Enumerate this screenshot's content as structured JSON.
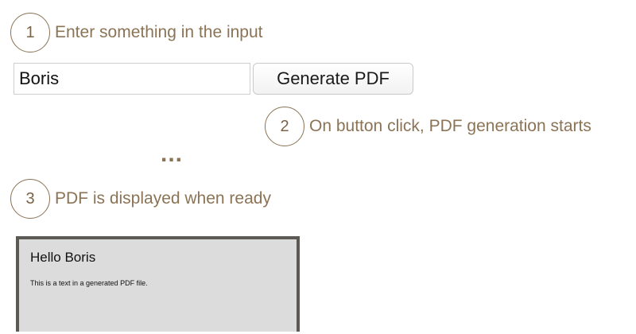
{
  "steps": [
    {
      "number": "1",
      "text": "Enter something in the input"
    },
    {
      "number": "2",
      "text": "On button click, PDF generation starts"
    },
    {
      "number": "3",
      "text": "PDF is displayed when ready"
    }
  ],
  "form": {
    "input_value": "Boris",
    "button_label": "Generate PDF"
  },
  "ellipsis": "...",
  "pdf": {
    "title": "Hello Boris",
    "body": "This is a text in a generated PDF file."
  },
  "colors": {
    "accent": "#8b7355",
    "pdf_background": "#dcdcdc",
    "pdf_border": "#5d5954"
  }
}
